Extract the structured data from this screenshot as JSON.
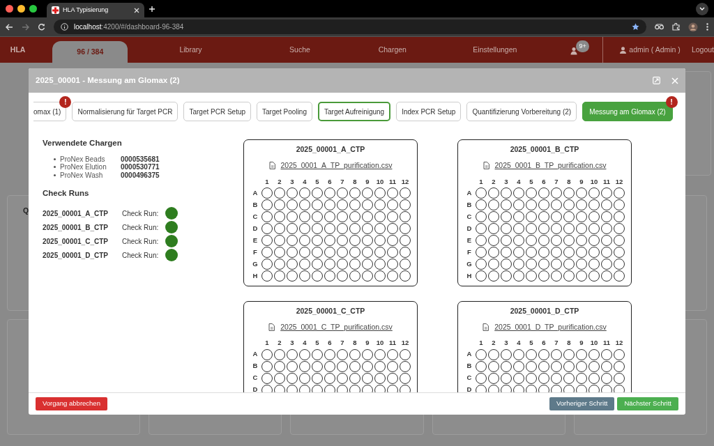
{
  "browser": {
    "tab_title": "HLA Typisierung",
    "url_host": "localhost",
    "url_rest": ":4200/#/dashboard-96-384"
  },
  "navbar": {
    "brand": "HLA",
    "items": [
      {
        "label": "96 / 384",
        "selected": true
      },
      {
        "label": "Library",
        "selected": false
      },
      {
        "label": "Suche",
        "selected": false
      },
      {
        "label": "Chargen",
        "selected": false
      },
      {
        "label": "Einstellungen",
        "selected": false
      }
    ],
    "notification_badge": "9+",
    "user": "admin ( Admin )",
    "logout": "Logout"
  },
  "background": {
    "card_text": "Q"
  },
  "modal": {
    "title": "2025_00001 - Messung am Glomax (2)",
    "steps": [
      {
        "label": "omax (1)",
        "selected": false,
        "current": false,
        "clipped_left": true,
        "badge": "!"
      },
      {
        "label": "Normalisierung für Target PCR",
        "selected": false,
        "current": false
      },
      {
        "label": "Target PCR Setup",
        "selected": false,
        "current": false
      },
      {
        "label": "Target Pooling",
        "selected": false,
        "current": false
      },
      {
        "label": "Target Aufreinigung",
        "selected": true,
        "current": false
      },
      {
        "label": "Index PCR Setup",
        "selected": false,
        "current": false
      },
      {
        "label": "Quantifizierung Vorbereitung (2)",
        "selected": false,
        "current": false
      },
      {
        "label": "Messung am Glomax (2)",
        "selected": false,
        "current": true,
        "badge": "!"
      }
    ],
    "chargen_title": "Verwendete Chargen",
    "chargen": [
      {
        "name": "ProNex Beads",
        "number": "0000535681"
      },
      {
        "name": "ProNex Elution",
        "number": "0000530771"
      },
      {
        "name": "ProNex Wash",
        "number": "0000496375"
      }
    ],
    "check_runs_title": "Check Runs",
    "check_runs": [
      {
        "name": "2025_00001_A_CTP",
        "label": "Check Run:",
        "color": "#2e7d1f"
      },
      {
        "name": "2025_00001_B_CTP",
        "label": "Check Run:",
        "color": "#2e7d1f"
      },
      {
        "name": "2025_00001_C_CTP",
        "label": "Check Run:",
        "color": "#2e7d1f"
      },
      {
        "name": "2025_00001_D_CTP",
        "label": "Check Run:",
        "color": "#2e7d1f"
      }
    ],
    "plates": [
      {
        "title": "2025_00001_A_CTP",
        "file": "2025_0001_A_TP_purification.csv",
        "columns": [
          "1",
          "2",
          "3",
          "4",
          "5",
          "6",
          "7",
          "8",
          "9",
          "10",
          "11",
          "12"
        ],
        "rows": [
          "A",
          "B",
          "C",
          "D",
          "E",
          "F",
          "G",
          "H"
        ]
      },
      {
        "title": "2025_00001_B_CTP",
        "file": "2025_0001_B_TP_purification.csv",
        "columns": [
          "1",
          "2",
          "3",
          "4",
          "5",
          "6",
          "7",
          "8",
          "9",
          "10",
          "11",
          "12"
        ],
        "rows": [
          "A",
          "B",
          "C",
          "D",
          "E",
          "F",
          "G",
          "H"
        ]
      },
      {
        "title": "2025_00001_C_CTP",
        "file": "2025_0001_C_TP_purification.csv",
        "columns": [
          "1",
          "2",
          "3",
          "4",
          "5",
          "6",
          "7",
          "8",
          "9",
          "10",
          "11",
          "12"
        ],
        "rows": [
          "A",
          "B",
          "C",
          "D"
        ]
      },
      {
        "title": "2025_00001_D_CTP",
        "file": "2025_0001_D_TP_purification.csv",
        "columns": [
          "1",
          "2",
          "3",
          "4",
          "5",
          "6",
          "7",
          "8",
          "9",
          "10",
          "11",
          "12"
        ],
        "rows": [
          "A",
          "B",
          "C",
          "D"
        ]
      }
    ],
    "footer": {
      "cancel": "Vorgang abbrechen",
      "previous": "Vorheriger Schritt",
      "next": "Nächster Schritt"
    }
  }
}
